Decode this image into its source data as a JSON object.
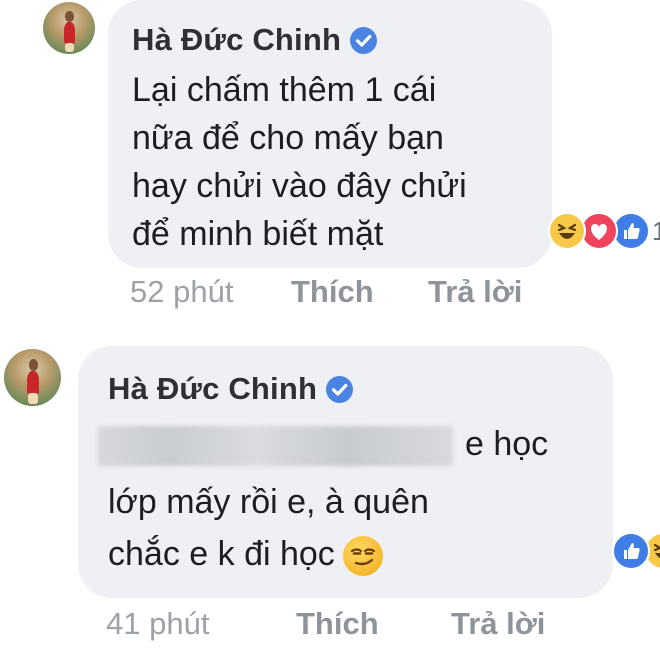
{
  "comments": [
    {
      "author": "Hà Đức Chinh",
      "lines": [
        "Lại chấm thêm 1 cái",
        "nữa để cho mấy bạn",
        "hay chửi vào đây chửi",
        "để minh biết mặt"
      ],
      "time": "52 phút",
      "like_label": "Thích",
      "reply_label": "Trả lời",
      "reactions": [
        "haha-icon",
        "love-icon",
        "like-icon"
      ]
    },
    {
      "author": "Hà Đức Chinh",
      "line1_suffix": "e học",
      "line2": "lớp mấy rồi e, à quên",
      "line3": "chắc e k đi học",
      "time": "41 phút",
      "like_label": "Thích",
      "reply_label": "Trả lời",
      "reactions": [
        "like-icon",
        "haha-icon"
      ]
    }
  ],
  "colors": {
    "bubble": "#eef0f3",
    "verified": "#4b83e3",
    "meta_text": "#9da1a8"
  }
}
